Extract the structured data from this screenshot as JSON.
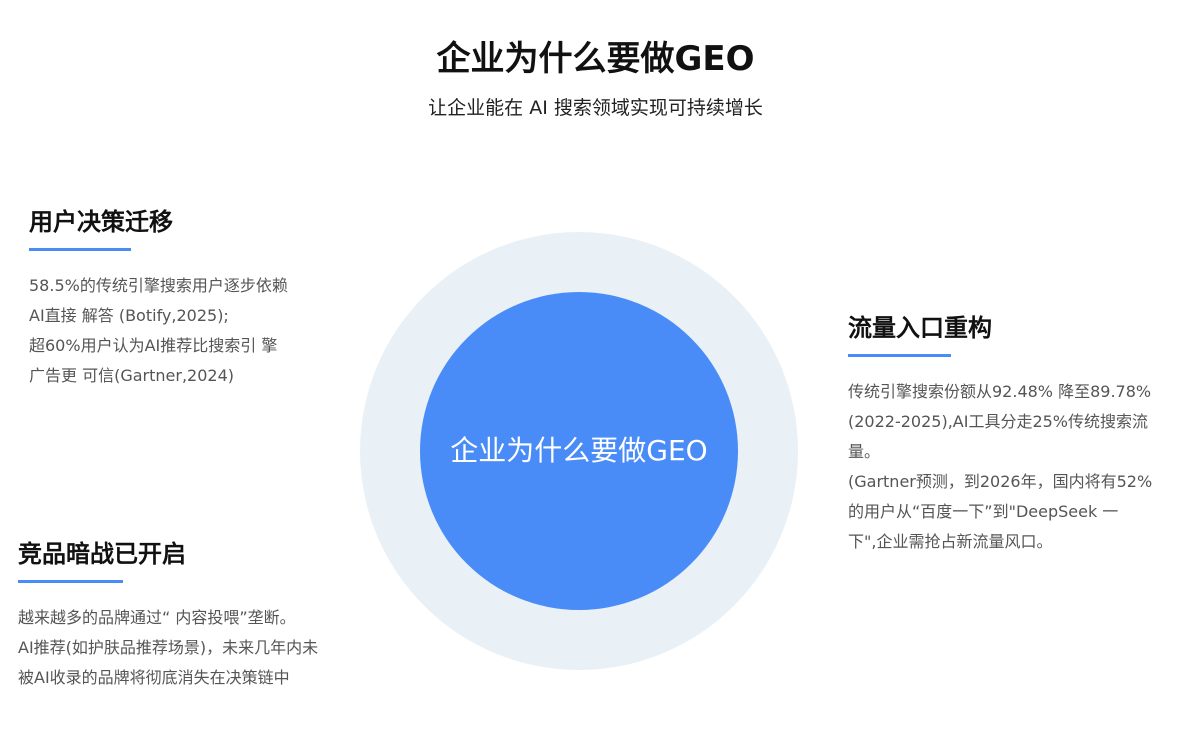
{
  "header": {
    "title": "企业为什么要做GEO",
    "subtitle": "让企业能在 AI 搜索领域实现可持续增长"
  },
  "center": {
    "label": "企业为什么要做GEO"
  },
  "colors": {
    "accent": "#4a8cf7",
    "ring": "#e9f1f7",
    "title": "#111111",
    "body_text": "#555555"
  },
  "blocks": {
    "decision": {
      "title": "用户决策迁移",
      "lines": [
        "58.5%的传统引擎搜索用户逐步依赖",
        "AI直接 解答 (Botify,2025);",
        "超60%用户认为AI推荐比搜索引 擎",
        "广告更  可信(Gartner,2024)"
      ]
    },
    "traffic": {
      "title": "流量入口重构",
      "lines": [
        "传统引擎搜索份额从92.48% 降至89.78%",
        "(2022-2025),AI工具分走25%传统搜索流",
        "量。",
        "(Gartner预测，到2026年，国内将有52%",
        "的用户从“百度一下”到\"DeepSeek 一",
        "下\",企业需抢占新流量风口。"
      ]
    },
    "competition": {
      "title": "竞品暗战已开启",
      "lines": [
        "越来越多的品牌通过“ 内容投喂”垄断。",
        "AI推荐(如护肤品推荐场景)，未来几年内未",
        "被AI收录的品牌将彻底消失在决策链中"
      ]
    }
  }
}
